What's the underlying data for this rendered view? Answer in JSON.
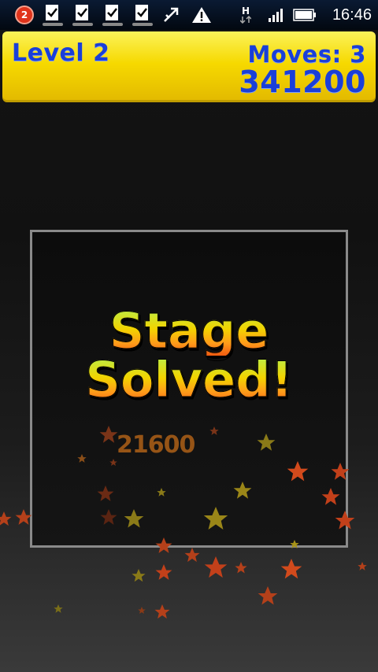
{
  "status_bar": {
    "notification_count": "2",
    "time": "16:46",
    "network_label": "H",
    "icons": [
      "notification-badge-icon",
      "task-check-icon",
      "task-check-icon",
      "task-check-icon",
      "task-check-icon",
      "usb-icon",
      "warning-icon",
      "network-h-icon",
      "signal-icon",
      "battery-icon"
    ]
  },
  "hud": {
    "level": "Level 2",
    "moves": "Moves: 3",
    "score": "341200"
  },
  "board": {
    "title_line1": "Stage",
    "title_line2": "Solved!",
    "points": "21600"
  },
  "colors": {
    "hud_yellow": "#f6d900",
    "hud_text_blue": "#1a3fd8",
    "board_border": "#8a8a8a",
    "star_orange": "#e0501c",
    "star_yellow": "#c9a81c"
  }
}
